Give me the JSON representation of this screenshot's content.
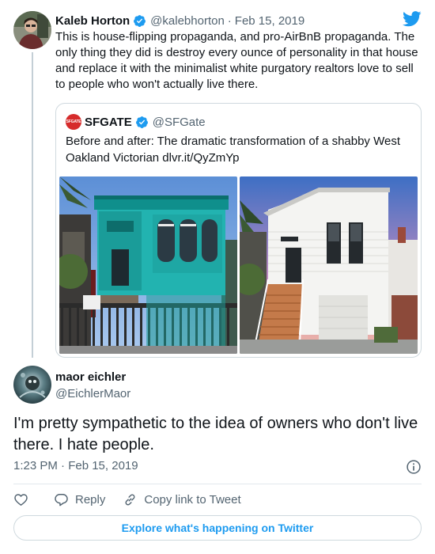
{
  "parent_tweet": {
    "author_name": "Kaleb Horton",
    "author_handle": "@kalebhorton",
    "separator": "·",
    "date": "Feb 15, 2019",
    "text": "This is house-flipping propaganda, and pro-AirBnB propaganda. The only thing they did is destroy every ounce of personality in that house and replace it with the minimalist white purgatory realtors love to sell to people who won't actually live there.",
    "quoted_tweet": {
      "avatar_text": "SFGATE",
      "author_name": "SFGATE",
      "author_handle": "@SFGate",
      "text": "Before and after: The dramatic transformation of a shabby West Oakland Victorian dlvr.it/QyZmYp",
      "media": [
        "before-photo-teal-victorian",
        "after-photo-white-house"
      ]
    }
  },
  "main_tweet": {
    "author_name": "maor eichler",
    "author_handle": "@EichlerMaor",
    "text": "I'm pretty sympathetic to the idea of owners who don't live there. I hate people.",
    "timestamp": "1:23 PM · Feb 15, 2019"
  },
  "actions": {
    "reply_label": "Reply",
    "copy_link_label": "Copy link to Tweet"
  },
  "explore_label": "Explore what's happening on Twitter",
  "colors": {
    "twitter_blue": "#1d9bf0",
    "verified_blue": "#1d9bf0",
    "secondary_text": "#536471",
    "border": "#cfd9de"
  },
  "icons": [
    "twitter-logo-icon",
    "verified-badge-icon",
    "info-icon",
    "heart-icon",
    "reply-icon",
    "link-icon"
  ]
}
